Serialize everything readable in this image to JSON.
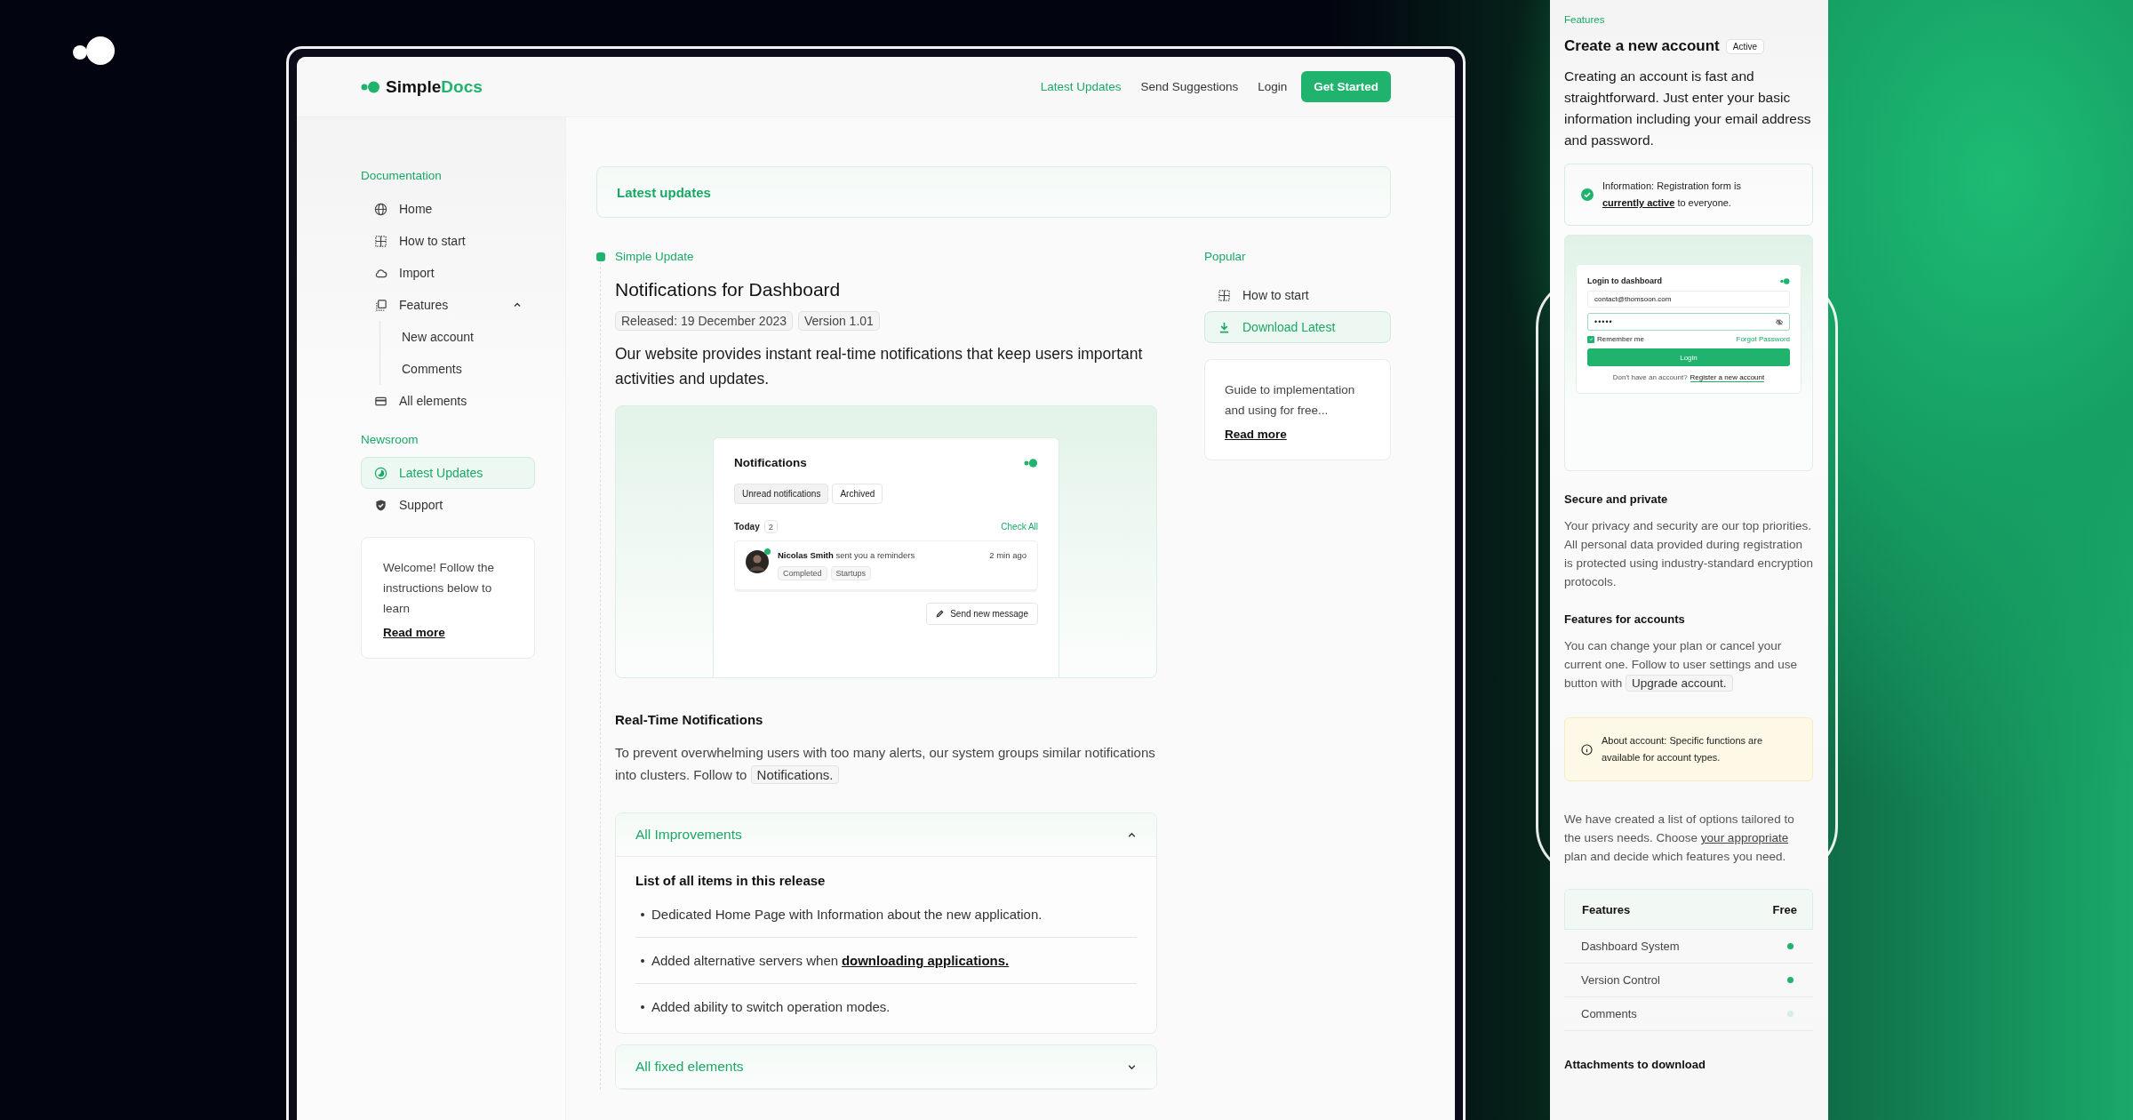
{
  "header": {
    "brand": {
      "name": "Simple",
      "accent": "Docs"
    },
    "nav": [
      {
        "label": "Latest Updates",
        "selected": true
      },
      {
        "label": "Send Suggestions",
        "selected": false
      },
      {
        "label": "Login",
        "selected": false
      }
    ],
    "cta": "Get Started"
  },
  "sidebar": {
    "sections": [
      {
        "title": "Documentation",
        "items": [
          {
            "label": "Home",
            "selected": false
          },
          {
            "label": "How to start",
            "selected": false
          },
          {
            "label": "Import",
            "selected": false
          },
          {
            "label": "Features",
            "selected": false,
            "expanded": true,
            "children": [
              {
                "label": "New account",
                "selected": false
              },
              {
                "label": "Comments",
                "selected": false
              }
            ]
          },
          {
            "label": "All elements",
            "selected": false
          }
        ]
      },
      {
        "title": "Newsroom",
        "items": [
          {
            "label": "Latest Updates",
            "selected": true
          },
          {
            "label": "Support",
            "selected": false
          }
        ]
      }
    ],
    "card": {
      "text": "Welcome! Follow the instructions below to learn",
      "link": "Read more"
    }
  },
  "banner": "Latest updates",
  "article": {
    "tag": "Simple Update",
    "title": "Notifications for Dashboard",
    "badges": [
      "Released: 19 December 2023",
      "Version 1.01"
    ],
    "lead": "Our website provides instant real-time notifications that keep users important activities and updates.",
    "preview": {
      "title": "Notifications",
      "tabs": [
        {
          "label": "Unread notifications",
          "selected": true
        },
        {
          "label": "Archived",
          "selected": false
        }
      ],
      "group": "Today",
      "count": "2",
      "action": "Check All",
      "item": {
        "name": "Nicolas Smith",
        "text": "sent you a reminders",
        "time": "2 min ago",
        "online": true,
        "tags": [
          "Completed",
          "Startups"
        ]
      },
      "button": "Send new message"
    },
    "section_title": "Real-Time Notifications",
    "section_text": "To prevent overwhelming users with too many alerts, our system groups similar notifications into clusters. Follow to",
    "section_chip": "Notifications.",
    "accordions": [
      {
        "title": "All Improvements",
        "expanded": true,
        "heading": "List of all items in this release",
        "items": [
          {
            "text": "Dedicated Home Page with Information about the new application."
          },
          {
            "text": "Added alternative servers when",
            "link": "downloading applications."
          },
          {
            "text": "Added ability to switch operation modes."
          }
        ]
      },
      {
        "title": "All fixed elements",
        "expanded": false
      }
    ]
  },
  "popular": {
    "title": "Popular",
    "links": [
      {
        "label": "How to start",
        "selected": false
      },
      {
        "label": "Download Latest",
        "selected": true
      }
    ],
    "card": {
      "text": "Guide to implementation and using for free...",
      "link": "Read more"
    }
  },
  "right_panel": {
    "eyebrow": "Features",
    "title": "Create a new account",
    "badge": "Active",
    "lead": "Creating an account is fast and straightforward. Just enter your basic information including your email address and password.",
    "info": {
      "before": "Information: Registration form is",
      "link": "currently active",
      "after": "to everyone."
    },
    "login_preview": {
      "title": "Login to dashboard",
      "email": "contact@thomsoon.com",
      "password": "•••••",
      "remember": {
        "label": "Remember me",
        "checked": true
      },
      "forgot": "Forgot Password",
      "button": "Login",
      "prompt": "Don't have an account?",
      "register": "Register a new account"
    },
    "secure": {
      "title": "Secure and private",
      "text": "Your privacy and security are our top priorities. All personal data provided during registration is protected using industry-standard encryption protocols."
    },
    "accounts": {
      "title": "Features for accounts",
      "text": "You can change your plan or cancel your current one. Follow to user settings and use button with",
      "chip": "Upgrade account."
    },
    "notice": "About account: Specific functions are available for account types.",
    "options": {
      "before": "We have created a list of options tailored to the users needs. Choose",
      "link": "your appropriate",
      "after": "plan and decide which features you need."
    },
    "table": {
      "columns": [
        "Features",
        "Free"
      ],
      "rows": [
        {
          "name": "Dashboard System",
          "included": true
        },
        {
          "name": "Version Control",
          "included": true
        },
        {
          "name": "Comments",
          "included": false
        }
      ]
    },
    "attachments_title": "Attachments to download"
  }
}
